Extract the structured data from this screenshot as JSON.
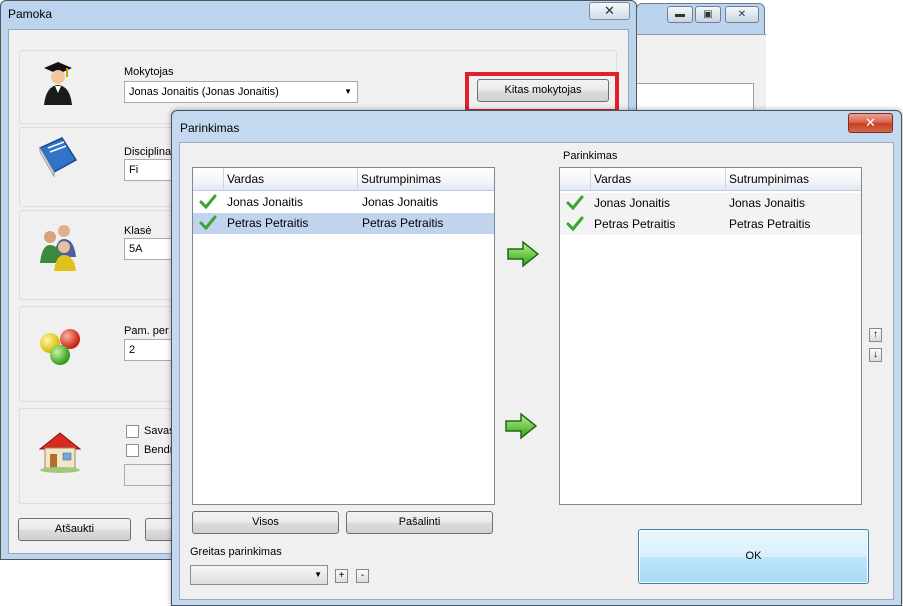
{
  "pamoka": {
    "title": "Pamoka",
    "close_glyph": "✕",
    "mokytojas_label": "Mokytojas",
    "mokytojas_value": "Jonas Jonaitis (Jonas Jonaitis)",
    "kitas_button": "Kitas mokytojas",
    "disciplina_label": "Disciplina",
    "disciplina_value": "Fi",
    "klase_label": "Klasė",
    "klase_value": "5A",
    "pam_label": "Pam. per s",
    "pam_value": "2",
    "savas_label": "Savas (",
    "bendra_label": "Bendra",
    "cancel_button": "Atšaukti"
  },
  "back_window": {
    "min_glyph": "▬",
    "max_glyph": "▣",
    "close_glyph": "✕"
  },
  "dialog": {
    "title": "Parinkimas",
    "close_glyph": "✕",
    "right_label": "Parinkimas",
    "columns": [
      "Vardas",
      "Sutrumpinimas"
    ],
    "left_rows": [
      {
        "vardas": "Jonas Jonaitis",
        "sutrumpinimas": "Jonas Jonaitis",
        "selected": false
      },
      {
        "vardas": "Petras Petraitis",
        "sutrumpinimas": "Petras Petraitis",
        "selected": true
      }
    ],
    "right_rows": [
      {
        "vardas": "Jonas Jonaitis",
        "sutrumpinimas": "Jonas Jonaitis"
      },
      {
        "vardas": "Petras Petraitis",
        "sutrumpinimas": "Petras Petraitis"
      }
    ],
    "visos_button": "Visos",
    "pasalinti_button": "Pašalinti",
    "greitas_label": "Greitas parinkimas",
    "greitas_value": "",
    "plus_glyph": "+",
    "minus_glyph": "-",
    "up_glyph": "↑",
    "down_glyph": "↓",
    "ok_button": "OK"
  },
  "colors": {
    "highlight_outline": "#e0202a",
    "selected_row": "#c2d3ee",
    "check_green": "#3aa52f",
    "arrow_green": "#4cc42a"
  }
}
